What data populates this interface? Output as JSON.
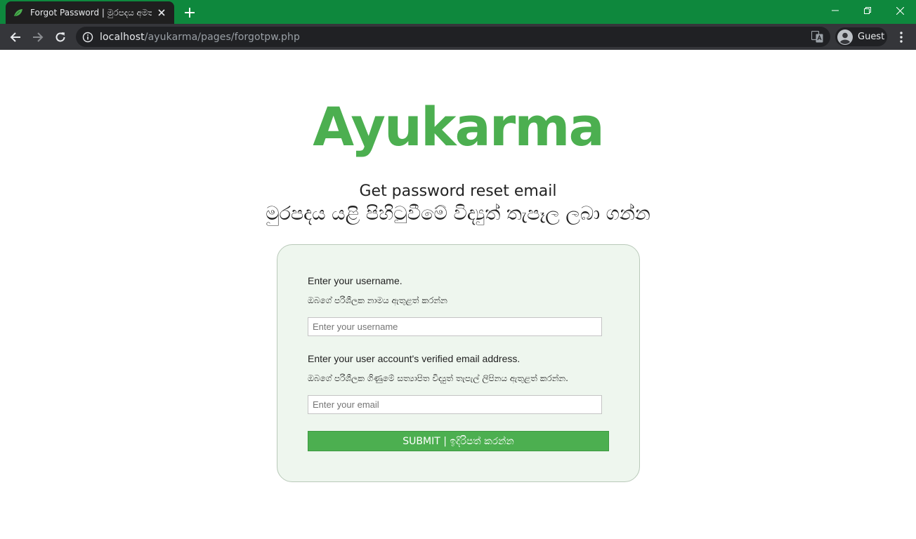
{
  "browser": {
    "tab": {
      "title": "Forgot Password | මුරපදය අමතක",
      "favicon": "ayukarma-leaf-icon"
    },
    "new_tab_icon": "plus-icon",
    "window_controls": [
      "minimize-icon",
      "restore-icon",
      "close-icon"
    ],
    "address": {
      "host": "localhost",
      "path": "/ayukarma/pages/forgotpw.php"
    },
    "profile_label": "Guest"
  },
  "page": {
    "logo_text": "Ayukarma",
    "heading_en": "Get password reset email",
    "heading_si": "මුරපදය යළි පිහිටුවීමේ විද්‍යුත් තැපෑල ලබා ගන්න",
    "form": {
      "username_label_en": "Enter your username.",
      "username_label_si": "ඔබගේ පරිශීලක නාමය ඇතුළත් කරන්න",
      "username_placeholder": "Enter your username",
      "email_label_en": "Enter your user account's verified email address.",
      "email_label_si": "ඔබගේ පරිශීලක ගිණුමේ සත්‍යාපිත විද්‍යුත් තැපැල් ලිපිනය ඇතුළත් කරන්න.",
      "email_placeholder": "Enter your email",
      "submit_label": "SUBMIT | ඉදිරිපත් කරන්න"
    }
  },
  "colors": {
    "brand_green": "#4caf50",
    "titlebar_green": "#0e883d",
    "card_background": "#eef6ee"
  }
}
